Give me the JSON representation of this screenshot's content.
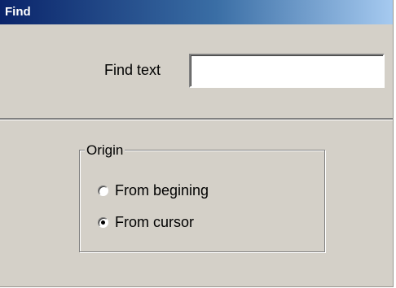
{
  "window": {
    "title": "Find"
  },
  "find": {
    "label": "Find text",
    "value": "",
    "placeholder": ""
  },
  "origin": {
    "legend": "Origin",
    "options": [
      {
        "label": "From begining",
        "selected": false
      },
      {
        "label": "From cursor",
        "selected": true
      }
    ]
  },
  "colors": {
    "titlebar_start": "#0a246a",
    "titlebar_end": "#a6caf0",
    "dialog_face": "#d4d0c8"
  }
}
